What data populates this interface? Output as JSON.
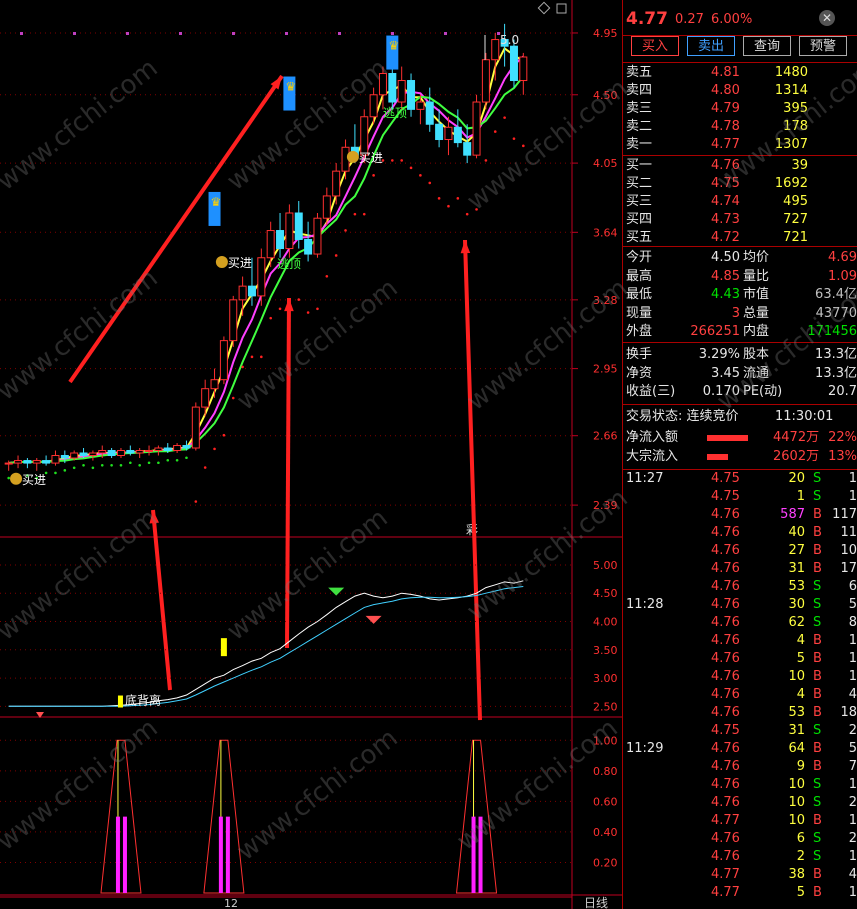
{
  "quote": {
    "price": "4.77",
    "change": "0.27",
    "change_pct": "6.00%"
  },
  "buttons": {
    "buy": "买入",
    "sell": "卖出",
    "query": "查询",
    "alert": "预警"
  },
  "order_book": {
    "asks": [
      {
        "label": "卖五",
        "price": "4.81",
        "vol": "1480"
      },
      {
        "label": "卖四",
        "price": "4.80",
        "vol": "1314"
      },
      {
        "label": "卖三",
        "price": "4.79",
        "vol": "395"
      },
      {
        "label": "卖二",
        "price": "4.78",
        "vol": "178"
      },
      {
        "label": "卖一",
        "price": "4.77",
        "vol": "1307"
      }
    ],
    "bids": [
      {
        "label": "买一",
        "price": "4.76",
        "vol": "39"
      },
      {
        "label": "买二",
        "price": "4.75",
        "vol": "1692"
      },
      {
        "label": "买三",
        "price": "4.74",
        "vol": "495"
      },
      {
        "label": "买四",
        "price": "4.73",
        "vol": "727"
      },
      {
        "label": "买五",
        "price": "4.72",
        "vol": "721"
      }
    ]
  },
  "stats": [
    {
      "l1": "今开",
      "v1": "4.50",
      "c1": "white",
      "l2": "均价",
      "v2": "4.69",
      "c2": "red"
    },
    {
      "l1": "最高",
      "v1": "4.85",
      "c1": "red",
      "l2": "量比",
      "v2": "1.09",
      "c2": "red"
    },
    {
      "l1": "最低",
      "v1": "4.43",
      "c1": "green",
      "l2": "市值",
      "v2": "63.4亿",
      "c2": "gray"
    },
    {
      "l1": "现量",
      "v1": "3",
      "c1": "red",
      "l2": "总量",
      "v2": "43770",
      "c2": "gray"
    },
    {
      "l1": "外盘",
      "v1": "266251",
      "c1": "red",
      "l2": "内盘",
      "v2": "171456",
      "c2": "green"
    }
  ],
  "fundamentals": [
    {
      "l1": "换手",
      "v1": "3.29%",
      "l2": "股本",
      "v2": "13.3亿"
    },
    {
      "l1": "净资",
      "v1": "3.45",
      "l2": "流通",
      "v2": "13.3亿"
    },
    {
      "l1": "收益(三)",
      "v1": "0.170",
      "l2": "PE(动)",
      "v2": "20.7"
    }
  ],
  "trade_status": {
    "label": "交易状态: 连续竞价",
    "time": "11:30:01"
  },
  "flows": [
    {
      "label": "净流入额",
      "value": "4472万",
      "pct": "22%",
      "bar": 0.9
    },
    {
      "label": "大宗流入",
      "value": "2602万",
      "pct": "13%",
      "bar": 0.45
    }
  ],
  "ticks": [
    {
      "time": "11:27",
      "price": "4.75",
      "vol": "20",
      "side": "S",
      "n": "1"
    },
    {
      "time": "",
      "price": "4.75",
      "vol": "1",
      "side": "S",
      "n": "1"
    },
    {
      "time": "",
      "price": "4.76",
      "vol": "587",
      "side": "B",
      "n": "117"
    },
    {
      "time": "",
      "price": "4.76",
      "vol": "40",
      "side": "B",
      "n": "11"
    },
    {
      "time": "",
      "price": "4.76",
      "vol": "27",
      "side": "B",
      "n": "10"
    },
    {
      "time": "",
      "price": "4.76",
      "vol": "31",
      "side": "B",
      "n": "17"
    },
    {
      "time": "",
      "price": "4.76",
      "vol": "53",
      "side": "S",
      "n": "6"
    },
    {
      "time": "11:28",
      "price": "4.76",
      "vol": "30",
      "side": "S",
      "n": "5"
    },
    {
      "time": "",
      "price": "4.76",
      "vol": "62",
      "side": "S",
      "n": "8"
    },
    {
      "time": "",
      "price": "4.76",
      "vol": "4",
      "side": "B",
      "n": "1"
    },
    {
      "time": "",
      "price": "4.76",
      "vol": "5",
      "side": "B",
      "n": "1"
    },
    {
      "time": "",
      "price": "4.76",
      "vol": "10",
      "side": "B",
      "n": "1"
    },
    {
      "time": "",
      "price": "4.76",
      "vol": "4",
      "side": "B",
      "n": "4"
    },
    {
      "time": "",
      "price": "4.76",
      "vol": "53",
      "side": "B",
      "n": "18"
    },
    {
      "time": "",
      "price": "4.75",
      "vol": "31",
      "side": "S",
      "n": "2"
    },
    {
      "time": "11:29",
      "price": "4.76",
      "vol": "64",
      "side": "B",
      "n": "5"
    },
    {
      "time": "",
      "price": "4.76",
      "vol": "9",
      "side": "B",
      "n": "7"
    },
    {
      "time": "",
      "price": "4.76",
      "vol": "10",
      "side": "S",
      "n": "1"
    },
    {
      "time": "",
      "price": "4.76",
      "vol": "10",
      "side": "S",
      "n": "2"
    },
    {
      "time": "",
      "price": "4.77",
      "vol": "10",
      "side": "B",
      "n": "1"
    },
    {
      "time": "",
      "price": "4.76",
      "vol": "6",
      "side": "S",
      "n": "2"
    },
    {
      "time": "",
      "price": "4.76",
      "vol": "2",
      "side": "S",
      "n": "1"
    },
    {
      "time": "",
      "price": "4.77",
      "vol": "38",
      "side": "B",
      "n": "4"
    },
    {
      "time": "",
      "price": "4.77",
      "vol": "5",
      "side": "B",
      "n": "1"
    }
  ],
  "labels": {
    "buy_in": "买进",
    "top_escape": "逃顶",
    "divergence": "底背离",
    "max_label": "5.0",
    "x_tick": "12",
    "period": "日线",
    "small_mark": "彩"
  },
  "watermark": "www.cfchi.com",
  "chart_data": [
    {
      "type": "candlestick",
      "yticks": [
        2.39,
        2.66,
        2.95,
        3.28,
        3.64,
        4.05,
        4.5,
        4.95
      ],
      "ylim": [
        2.3,
        5.05
      ],
      "log_scale": true,
      "candles": [
        [
          2.55,
          2.56,
          2.52,
          2.55
        ],
        [
          2.55,
          2.58,
          2.53,
          2.56
        ],
        [
          2.56,
          2.57,
          2.53,
          2.55
        ],
        [
          2.55,
          2.57,
          2.52,
          2.56
        ],
        [
          2.56,
          2.58,
          2.54,
          2.55
        ],
        [
          2.55,
          2.6,
          2.54,
          2.58
        ],
        [
          2.58,
          2.6,
          2.55,
          2.57
        ],
        [
          2.57,
          2.6,
          2.56,
          2.59
        ],
        [
          2.59,
          2.61,
          2.57,
          2.58
        ],
        [
          2.58,
          2.6,
          2.56,
          2.59
        ],
        [
          2.59,
          2.62,
          2.57,
          2.6
        ],
        [
          2.6,
          2.61,
          2.57,
          2.58
        ],
        [
          2.58,
          2.61,
          2.57,
          2.6
        ],
        [
          2.6,
          2.62,
          2.58,
          2.59
        ],
        [
          2.59,
          2.61,
          2.57,
          2.6
        ],
        [
          2.6,
          2.62,
          2.58,
          2.6
        ],
        [
          2.6,
          2.62,
          2.58,
          2.61
        ],
        [
          2.61,
          2.63,
          2.59,
          2.6
        ],
        [
          2.6,
          2.63,
          2.59,
          2.62
        ],
        [
          2.62,
          2.64,
          2.6,
          2.61
        ],
        [
          2.61,
          2.8,
          2.6,
          2.78
        ],
        [
          2.78,
          2.9,
          2.74,
          2.86
        ],
        [
          2.86,
          2.95,
          2.82,
          2.9
        ],
        [
          2.9,
          3.1,
          2.88,
          3.08
        ],
        [
          3.08,
          3.3,
          3.05,
          3.28
        ],
        [
          3.28,
          3.4,
          3.2,
          3.35
        ],
        [
          3.35,
          3.5,
          3.25,
          3.3
        ],
        [
          3.3,
          3.55,
          3.25,
          3.5
        ],
        [
          3.5,
          3.7,
          3.45,
          3.65
        ],
        [
          3.65,
          3.75,
          3.5,
          3.55
        ],
        [
          3.55,
          3.8,
          3.5,
          3.75
        ],
        [
          3.75,
          3.82,
          3.55,
          3.6
        ],
        [
          3.6,
          3.7,
          3.48,
          3.52
        ],
        [
          3.52,
          3.75,
          3.5,
          3.72
        ],
        [
          3.72,
          3.9,
          3.68,
          3.85
        ],
        [
          3.85,
          4.05,
          3.8,
          4.0
        ],
        [
          4.0,
          4.2,
          3.95,
          4.15
        ],
        [
          4.15,
          4.3,
          4.05,
          4.1
        ],
        [
          4.1,
          4.4,
          4.05,
          4.35
        ],
        [
          4.35,
          4.55,
          4.3,
          4.5
        ],
        [
          4.5,
          4.7,
          4.4,
          4.65
        ],
        [
          4.65,
          4.72,
          4.4,
          4.45
        ],
        [
          4.45,
          4.7,
          4.4,
          4.6
        ],
        [
          4.6,
          4.65,
          4.35,
          4.4
        ],
        [
          4.4,
          4.5,
          4.3,
          4.45
        ],
        [
          4.45,
          4.55,
          4.25,
          4.3
        ],
        [
          4.3,
          4.4,
          4.15,
          4.2
        ],
        [
          4.2,
          4.35,
          4.1,
          4.28
        ],
        [
          4.28,
          4.4,
          4.15,
          4.18
        ],
        [
          4.18,
          4.3,
          4.05,
          4.1
        ],
        [
          4.1,
          4.5,
          4.08,
          4.45
        ],
        [
          4.45,
          4.8,
          4.4,
          4.75
        ],
        [
          4.75,
          4.95,
          4.6,
          4.9
        ],
        [
          4.9,
          5.02,
          4.7,
          4.85
        ],
        [
          4.85,
          4.9,
          4.55,
          4.6
        ],
        [
          4.6,
          4.8,
          4.5,
          4.77
        ]
      ],
      "mas": [
        {
          "name": "",
          "color": "#ffff40",
          "window": 3
        },
        {
          "name": "",
          "color": "#ff40ff",
          "window": 5
        },
        {
          "name": "",
          "color": "#40ff40",
          "window": 7
        }
      ]
    },
    {
      "type": "line",
      "yticks": [
        2.5,
        3.0,
        3.5,
        4.0,
        4.5,
        5.0
      ],
      "ylim": [
        2.4,
        5.3
      ],
      "series": [
        {
          "name": "",
          "color": "#ffffff",
          "values": [
            2.5,
            2.5,
            2.5,
            2.5,
            2.5,
            2.5,
            2.5,
            2.5,
            2.5,
            2.5,
            2.5,
            2.51,
            2.52,
            2.53,
            2.55,
            2.57,
            2.6,
            2.62,
            2.65,
            2.7,
            2.8,
            2.9,
            3.0,
            3.05,
            3.15,
            3.22,
            3.3,
            3.35,
            3.45,
            3.52,
            3.65,
            3.78,
            3.9,
            4.0,
            4.12,
            4.25,
            4.35,
            4.45,
            4.5,
            4.45,
            4.42,
            4.45,
            4.5,
            4.48,
            4.45,
            4.4,
            4.38,
            4.4,
            4.42,
            4.45,
            4.5,
            4.6,
            4.65,
            4.7,
            4.68,
            4.72
          ]
        },
        {
          "name": "",
          "color": "#40d0ff",
          "values": [
            2.5,
            2.5,
            2.5,
            2.5,
            2.5,
            2.5,
            2.5,
            2.5,
            2.5,
            2.5,
            2.5,
            2.5,
            2.5,
            2.51,
            2.52,
            2.53,
            2.55,
            2.57,
            2.6,
            2.63,
            2.7,
            2.78,
            2.86,
            2.93,
            3.0,
            3.07,
            3.14,
            3.2,
            3.28,
            3.35,
            3.45,
            3.55,
            3.65,
            3.75,
            3.85,
            3.95,
            4.05,
            4.15,
            4.25,
            4.3,
            4.33,
            4.36,
            4.4,
            4.42,
            4.43,
            4.43,
            4.42,
            4.42,
            4.43,
            4.44,
            4.46,
            4.5,
            4.54,
            4.58,
            4.6,
            4.62
          ]
        }
      ]
    },
    {
      "type": "bar",
      "yticks": [
        0.2,
        0.4,
        0.6,
        0.8,
        1.0
      ],
      "ylim": [
        0,
        1.1
      ],
      "signals": [
        {
          "index": 12,
          "value": 1.0
        },
        {
          "index": 23,
          "value": 1.0
        },
        {
          "index": 50,
          "value": 1.0
        }
      ]
    }
  ]
}
